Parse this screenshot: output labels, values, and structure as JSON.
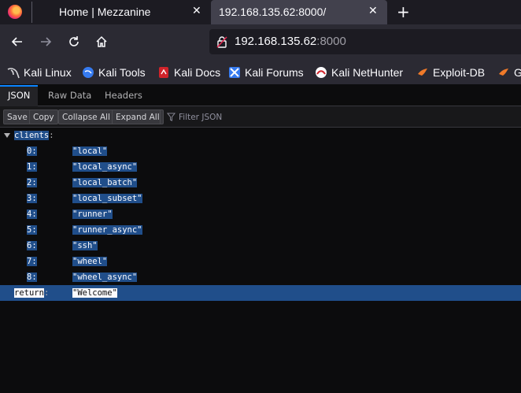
{
  "tabs": [
    {
      "title": "Home | Mezzanine",
      "close": "✕"
    },
    {
      "title": "192.168.135.62:8000/",
      "close": "✕"
    }
  ],
  "new_tab_label": "+",
  "urlbar": {
    "host": "192.168.135.62",
    "port": ":8000"
  },
  "bookmarks": [
    {
      "label": "Kali Linux",
      "icon": "kali-dragon-icon"
    },
    {
      "label": "Kali Tools",
      "icon": "kali-tools-icon"
    },
    {
      "label": "Kali Docs",
      "icon": "kali-docs-icon"
    },
    {
      "label": "Kali Forums",
      "icon": "kali-forums-icon"
    },
    {
      "label": "Kali NetHunter",
      "icon": "nethunter-icon"
    },
    {
      "label": "Exploit-DB",
      "icon": "exploitdb-icon"
    },
    {
      "label": "G",
      "icon": "exploitdb-icon"
    }
  ],
  "viewer_tabs": [
    "JSON",
    "Raw Data",
    "Headers"
  ],
  "toolbar": {
    "save": "Save",
    "copy": "Copy",
    "collapse_all": "Collapse All",
    "expand_all": "Expand All",
    "filter_placeholder": "Filter JSON"
  },
  "json": {
    "root_key": "clients",
    "colon": ":",
    "clients": [
      {
        "index": "0:",
        "value": "\"local\""
      },
      {
        "index": "1:",
        "value": "\"local_async\""
      },
      {
        "index": "2:",
        "value": "\"local_batch\""
      },
      {
        "index": "3:",
        "value": "\"local_subset\""
      },
      {
        "index": "4:",
        "value": "\"runner\""
      },
      {
        "index": "5:",
        "value": "\"runner_async\""
      },
      {
        "index": "6:",
        "value": "\"ssh\""
      },
      {
        "index": "7:",
        "value": "\"wheel\""
      },
      {
        "index": "8:",
        "value": "\"wheel_async\""
      }
    ],
    "return_key": "return",
    "return_value": "\"Welcome\""
  },
  "colors": {
    "accent": "#0a84ff",
    "selection": "#204e8a",
    "background": "#0c0c0d"
  }
}
